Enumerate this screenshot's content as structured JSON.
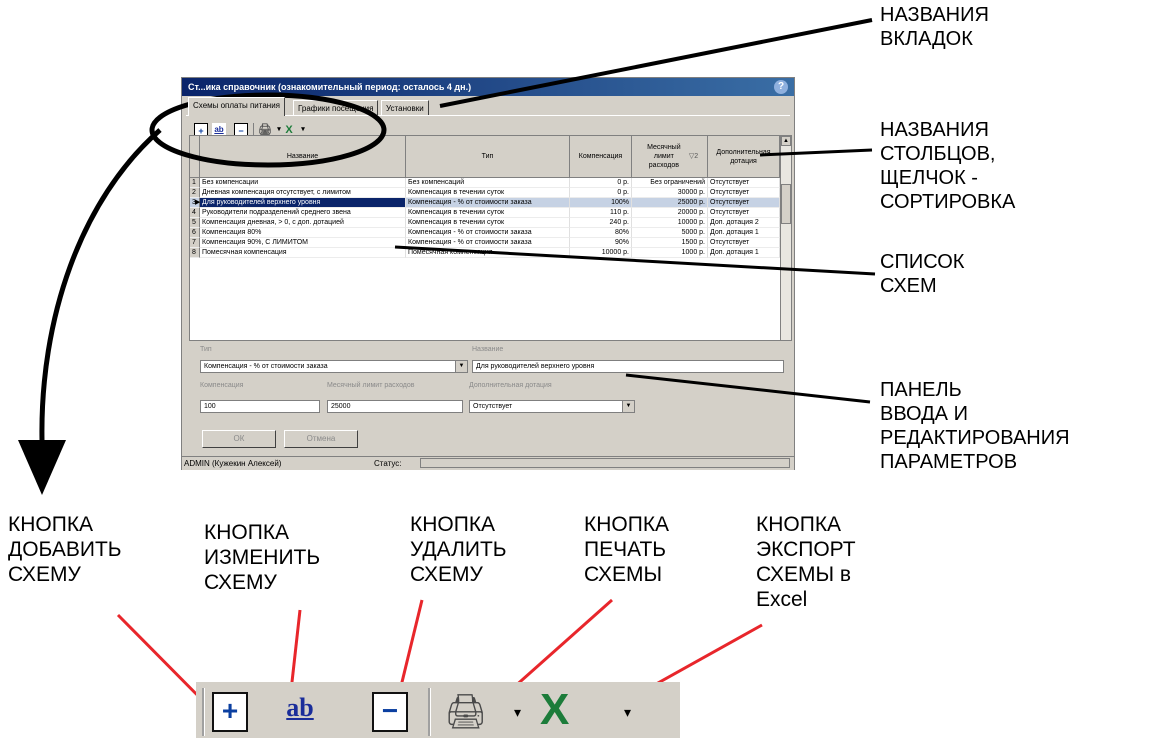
{
  "window": {
    "title": "Ст...ика справочник (ознакомительный период: осталось 4 дн.)",
    "help_icon": "help-icon"
  },
  "tabs": [
    {
      "label": "Схемы оплаты питания"
    },
    {
      "label": "Графики посещения"
    },
    {
      "label": "Установки"
    }
  ],
  "toolbar": {
    "add": "+",
    "edit": "ab",
    "delete": "−",
    "print": "🖨",
    "excel": "X",
    "dropdown": "▾"
  },
  "grid": {
    "headers": [
      "Название",
      "Тип",
      "Компенсация",
      "Месячный лимит расходов",
      "Дополнительная дотация"
    ],
    "sort_mark": "▽2",
    "rows": [
      {
        "n": "1",
        "name": "Без компенсации",
        "type": "Без компенсаций",
        "comp": "0 р.",
        "limit": "Без ограничений",
        "extra": "Отсутствует"
      },
      {
        "n": "2",
        "name": "Дневная компенсация отсутствует, с лимитом",
        "type": "Компенсация в течении суток",
        "comp": "0 р.",
        "limit": "30000 р.",
        "extra": "Отсутствует"
      },
      {
        "n": "3",
        "name": "Для руководителей верхнего уровня",
        "type": "Компенсация - % от стоимости заказа",
        "comp": "100%",
        "limit": "25000 р.",
        "extra": "Отсутствует"
      },
      {
        "n": "4",
        "name": "Руководители подразделений среднего звена",
        "type": "Компенсация в течении суток",
        "comp": "110 р.",
        "limit": "20000 р.",
        "extra": "Отсутствует"
      },
      {
        "n": "5",
        "name": "Компенсация дневная, > 0, с доп. дотацией",
        "type": "Компенсация в течении суток",
        "comp": "240 р.",
        "limit": "10000 р.",
        "extra": "Доп. дотация 2"
      },
      {
        "n": "6",
        "name": "Компенсация 80%",
        "type": "Компенсация - % от стоимости заказа",
        "comp": "80%",
        "limit": "5000 р.",
        "extra": "Доп. дотация 1"
      },
      {
        "n": "7",
        "name": "Компенсация 90%, С ЛИМИТОМ",
        "type": "Компенсация - % от стоимости заказа",
        "comp": "90%",
        "limit": "1500 р.",
        "extra": "Отсутствует"
      },
      {
        "n": "8",
        "name": "Помесячная компенсация",
        "type": "Помесячная компенсация",
        "comp": "10000 р.",
        "limit": "1000 р.",
        "extra": "Доп. дотация 1"
      }
    ],
    "new_row_marker": "0",
    "selected_marker": "▶"
  },
  "form": {
    "type_label": "Тип",
    "type_value": "Компенсация - % от стоимости заказа",
    "name_label": "Название",
    "name_value": "Для руководителей верхнего уровня",
    "comp_label": "Компенсация",
    "comp_value": "100",
    "limit_label": "Месячный лимит расходов",
    "limit_value": "25000",
    "extra_label": "Дополнительная дотация",
    "extra_value": "Отсутствует",
    "ok_label": "ОК",
    "cancel_label": "Отмена"
  },
  "status": {
    "user": "ADMIN (Кужекин Алексей)",
    "status_label": "Статус:"
  },
  "annotations": {
    "tabs_names": "НАЗВАНИЯ\nВКЛАДОК",
    "column_names": "НАЗВАНИЯ\nСТОЛБЦОВ,\nЩЕЛЧОК -\nСОРТИРОВКА",
    "schemes_list": "СПИСОК\nСХЕМ",
    "edit_panel": "ПАНЕЛЬ\nВВОДА И\nРЕДАКТИРОВАНИЯ\nПАРАМЕТРОВ",
    "btn_add": "КНОПКА\nДОБАВИТЬ\nСХЕМУ",
    "btn_edit": "КНОПКА\nИЗМЕНИТЬ\nСХЕМУ",
    "btn_delete": "КНОПКА\nУДАЛИТЬ\nСХЕМУ",
    "btn_print": "КНОПКА\nПЕЧАТЬ\nСХЕМЫ",
    "btn_export": "КНОПКА\nЭКСПОРТ\nСХЕМЫ в\nExcel"
  },
  "colors": {
    "callout_red": "#e8262b",
    "selection_blue": "#0a246a",
    "new_row_yellow": "#fdf7c6",
    "excel_green": "#1c7c3a"
  }
}
